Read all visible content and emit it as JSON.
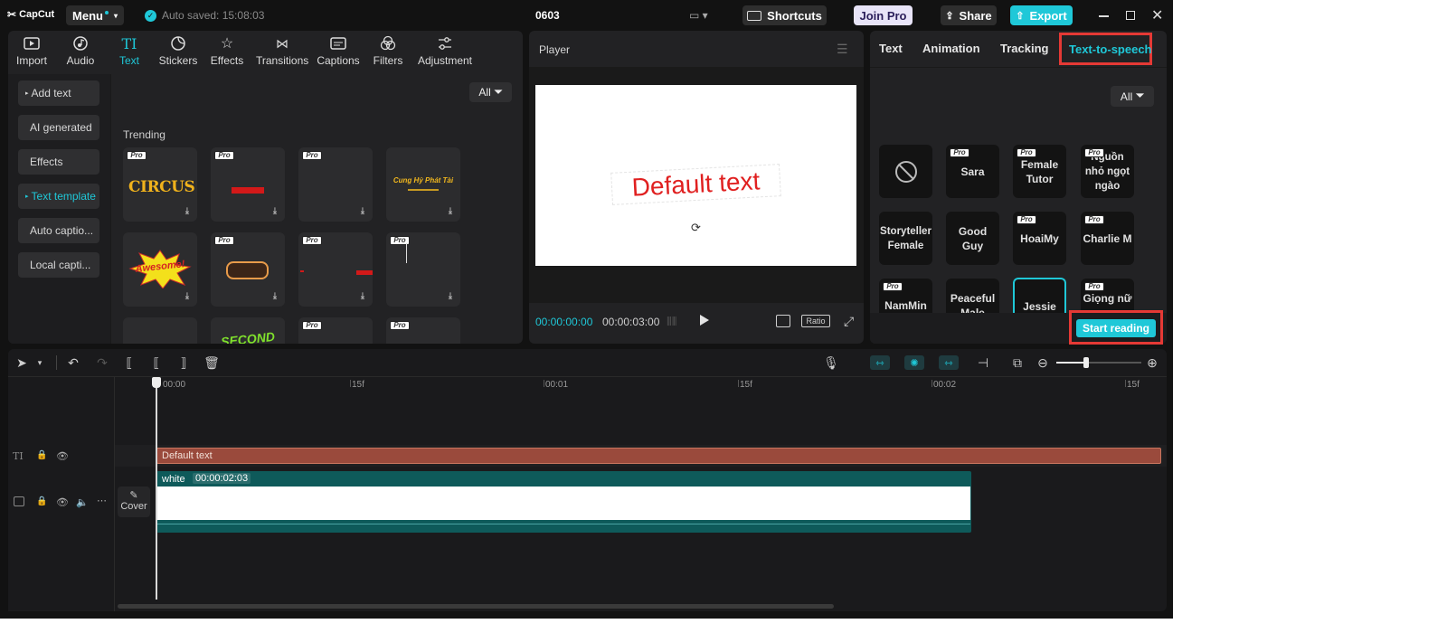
{
  "app": {
    "logo": "CapCut",
    "menu_label": "Menu",
    "autosave": "Auto saved: 15:08:03",
    "project_name": "0603",
    "shortcuts_label": "Shortcuts",
    "join_pro_label": "Join Pro",
    "share_label": "Share",
    "export_label": "Export"
  },
  "toolbar": {
    "items": [
      {
        "label": "Import",
        "icon": "import-icon"
      },
      {
        "label": "Audio",
        "icon": "audio-icon"
      },
      {
        "label": "Text",
        "icon": "text-icon",
        "active": true
      },
      {
        "label": "Stickers",
        "icon": "stickers-icon"
      },
      {
        "label": "Effects",
        "icon": "effects-icon"
      },
      {
        "label": "Transitions",
        "icon": "transitions-icon"
      },
      {
        "label": "Captions",
        "icon": "captions-icon"
      },
      {
        "label": "Filters",
        "icon": "filters-icon"
      },
      {
        "label": "Adjustment",
        "icon": "adjustment-icon"
      }
    ]
  },
  "sidebar": {
    "items": [
      {
        "label": "Add text"
      },
      {
        "label": "AI generated"
      },
      {
        "label": "Effects"
      },
      {
        "label": "Text template",
        "active": true
      },
      {
        "label": "Auto captio..."
      },
      {
        "label": "Local capti..."
      }
    ]
  },
  "library": {
    "filter_label": "All",
    "section_title": "Trending",
    "pro_badge": "Pro",
    "tile_texts": [
      "CIRCUS",
      "Cung Hỷ Phát Tài",
      "Awesome!",
      "SECOND"
    ]
  },
  "player": {
    "title": "Player",
    "canvas_text": "Default text",
    "current_time": "00:00:00:00",
    "total_time": "00:00:03:00",
    "ratio_label": "Ratio"
  },
  "right_panel": {
    "tabs": [
      "Text",
      "Animation",
      "Tracking",
      "Text-to-speech"
    ],
    "active_tab": "Text-to-speech",
    "filter_label": "All",
    "voices": [
      {
        "name": "",
        "pro": false,
        "icon": "none-icon"
      },
      {
        "name": "Sara",
        "pro": true
      },
      {
        "name": "Female Tutor",
        "pro": true
      },
      {
        "name": "Nguồn nhỏ ngọt ngào",
        "pro": true
      },
      {
        "name": "Storyteller Female",
        "pro": false
      },
      {
        "name": "Good Guy",
        "pro": false
      },
      {
        "name": "HoaiMy",
        "pro": true
      },
      {
        "name": "Charlie M",
        "pro": true
      },
      {
        "name": "NamMin",
        "pro": true
      },
      {
        "name": "Peaceful Male",
        "pro": false
      },
      {
        "name": "Jessie",
        "pro": false,
        "selected": true
      },
      {
        "name": "Giọng nữ",
        "pro": true
      }
    ],
    "start_reading_label": "Start reading"
  },
  "timeline": {
    "ruler_labels": [
      "00:00",
      "15f",
      "00:01",
      "15f",
      "00:02",
      "15f"
    ],
    "text_clip_label": "Default text",
    "video_clip_name": "white",
    "video_clip_duration": "00:00:02:03",
    "cover_label": "Cover"
  },
  "colors": {
    "accent": "#1fc8d8",
    "highlight_box": "#e53935",
    "text_clip": "#9a4a3c",
    "video_clip": "#0e5a5a"
  }
}
